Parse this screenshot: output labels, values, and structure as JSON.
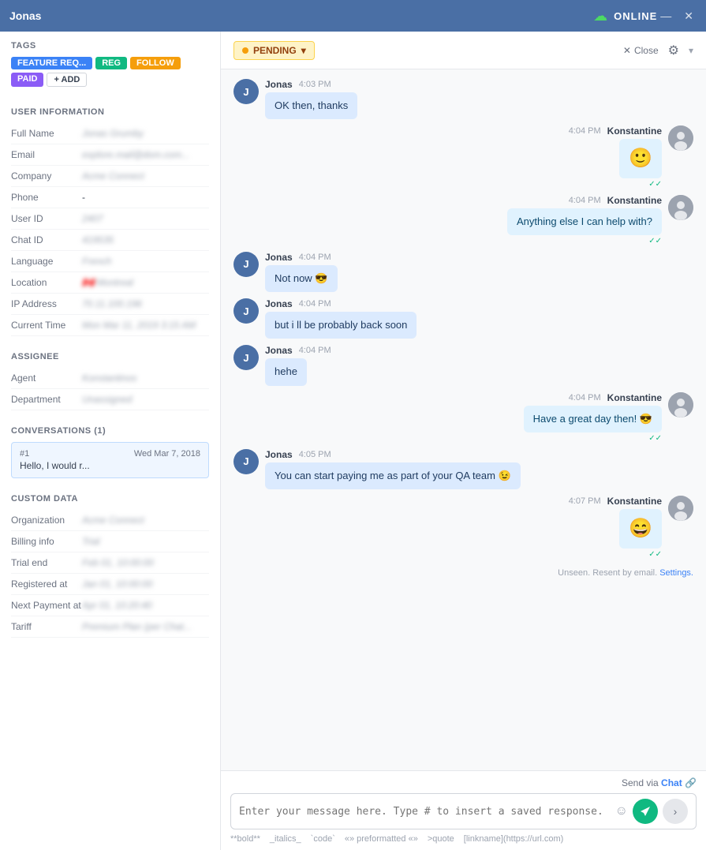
{
  "titleBar": {
    "appName": "Jonas",
    "statusIcon": "☁",
    "statusText": "ONLINE",
    "minimizeBtn": "—",
    "closeBtn": "✕"
  },
  "header": {
    "pendingLabel": "PENDING",
    "closeLabel": "Close",
    "settingsLabel": "⚙"
  },
  "sidebar": {
    "tagsTitle": "TAGS",
    "tags": [
      {
        "label": "FEATURE REQ...",
        "color": "tag-blue"
      },
      {
        "label": "REG",
        "color": "tag-green"
      },
      {
        "label": "FOLLOW",
        "color": "tag-orange"
      },
      {
        "label": "PAID",
        "color": "tag-purple"
      }
    ],
    "addTag": "+ ADD",
    "userInfoTitle": "USER INFORMATION",
    "userFields": [
      {
        "label": "Full Name",
        "value": "Jonas",
        "blurred": true
      },
      {
        "label": "Email",
        "value": "someone@domain.com...",
        "blurred": true
      },
      {
        "label": "Company",
        "value": "Acme Corp",
        "blurred": true
      },
      {
        "label": "Phone",
        "value": "-",
        "blurred": false
      },
      {
        "label": "User ID",
        "value": "2407",
        "blurred": true
      },
      {
        "label": "Chat ID",
        "value": "419535",
        "blurred": true
      },
      {
        "label": "Language",
        "value": "French",
        "blurred": true
      },
      {
        "label": "Location",
        "value": "Montreal",
        "blurred": true,
        "hasFlag": true
      },
      {
        "label": "IP Address",
        "value": "70.11.100.196",
        "blurred": true
      },
      {
        "label": "Current Time",
        "value": "Mon Mar 11, 2019 3:15 AM",
        "blurred": true
      }
    ],
    "assigneeTitle": "ASSIGNEE",
    "assigneeFields": [
      {
        "label": "Agent",
        "value": "Konstantinos",
        "blurred": true
      },
      {
        "label": "Department",
        "value": "Unassigned",
        "blurred": true
      }
    ],
    "conversationsTitle": "CONVERSATIONS (1)",
    "conversations": [
      {
        "num": "#1",
        "preview": "Hello, I would r...",
        "date": "Wed Mar 7, 2018"
      }
    ],
    "customDataTitle": "CUSTOM DATA",
    "customFields": [
      {
        "label": "Organization",
        "value": "Acme Corp",
        "blurred": true
      },
      {
        "label": "Billing info",
        "value": "Trial",
        "blurred": true
      },
      {
        "label": "Trial end",
        "value": "Feb 01, 10:00:00",
        "blurred": true
      },
      {
        "label": "Registered at",
        "value": "Jan 01, 10:00:00",
        "blurred": true
      },
      {
        "label": "Next Payment at",
        "value": "Apr 01, 10:20:40",
        "blurred": true
      },
      {
        "label": "Tariff",
        "value": "Premium Plan (per Chat...",
        "blurred": true
      }
    ]
  },
  "chat": {
    "messages": [
      {
        "id": 1,
        "sender": "Jonas",
        "time": "4:03 PM",
        "type": "user",
        "text": "OK then, thanks",
        "emoji": false
      },
      {
        "id": 2,
        "sender": "Konstantine",
        "time": "4:04 PM",
        "type": "agent",
        "text": "🙂",
        "emoji": true,
        "ticks": "✓✓"
      },
      {
        "id": 3,
        "sender": "Konstantine",
        "time": "4:04 PM",
        "type": "agent",
        "text": "Anything else I can help with?",
        "emoji": false,
        "ticks": "✓✓"
      },
      {
        "id": 4,
        "sender": "Jonas",
        "time": "4:04 PM",
        "type": "user",
        "text": "Not now 😎",
        "emoji": false
      },
      {
        "id": 5,
        "sender": "Jonas",
        "time": "4:04 PM",
        "type": "user",
        "text": "but i ll be probably back soon",
        "emoji": false
      },
      {
        "id": 6,
        "sender": "Jonas",
        "time": "4:04 PM",
        "type": "user",
        "text": "hehe",
        "emoji": false
      },
      {
        "id": 7,
        "sender": "Konstantine",
        "time": "4:04 PM",
        "type": "agent",
        "text": "Have a great day then! 😎",
        "emoji": false,
        "ticks": "✓✓"
      },
      {
        "id": 8,
        "sender": "Jonas",
        "time": "4:05 PM",
        "type": "user",
        "text": "You can start paying me as part of your QA team 😉",
        "emoji": false
      },
      {
        "id": 9,
        "sender": "Konstantine",
        "time": "4:07 PM",
        "type": "agent",
        "text": "😄",
        "emoji": true,
        "ticks": "✓✓"
      }
    ],
    "unseenNote": "Unseen. Resent by email.",
    "settingsLink": "Settings.",
    "sendViaLabel": "Send via",
    "sendViaChannel": "Chat",
    "inputPlaceholder": "Enter your message here. Type # to insert a saved response.",
    "toolbar": [
      "**bold**",
      "_italics_",
      "`code`",
      "\"\" preformatted \"\"",
      ">quote",
      "[linkname](https://url.com)"
    ]
  }
}
